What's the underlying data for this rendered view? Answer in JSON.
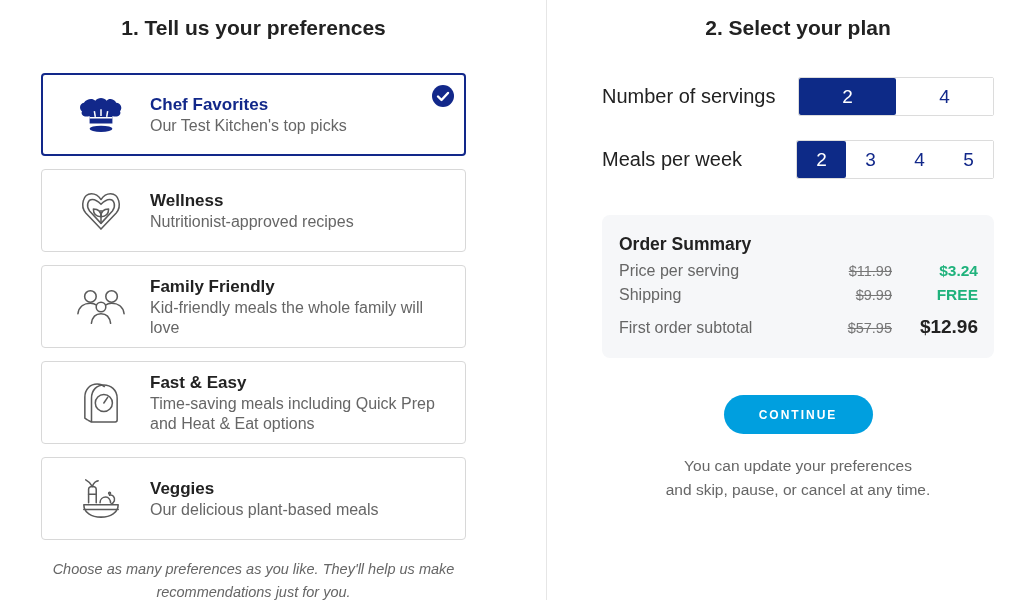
{
  "preferences": {
    "title": "1. Tell us your preferences",
    "options": [
      {
        "title": "Chef Favorites",
        "description": "Our Test Kitchen's top picks",
        "selected": true
      },
      {
        "title": "Wellness",
        "description": "Nutritionist-approved recipes",
        "selected": false
      },
      {
        "title": "Family Friendly",
        "description": "Kid-friendly meals the whole family will love",
        "selected": false
      },
      {
        "title": "Fast & Easy",
        "description": "Time-saving meals including Quick Prep and Heat & Eat options",
        "selected": false
      },
      {
        "title": "Veggies",
        "description": "Our delicious plant-based meals",
        "selected": false
      }
    ],
    "note": "Choose as many preferences as you like. They'll help us make recommendations just for you."
  },
  "plan": {
    "title": "2. Select your plan",
    "servings": {
      "label": "Number of servings",
      "options": [
        {
          "label": "2",
          "selected": true
        },
        {
          "label": "4",
          "selected": false
        }
      ]
    },
    "meals_per_week": {
      "label": "Meals per week",
      "options": [
        {
          "label": "2",
          "selected": true
        },
        {
          "label": "3",
          "selected": false
        },
        {
          "label": "4",
          "selected": false
        },
        {
          "label": "5",
          "selected": false
        }
      ]
    },
    "order_summary": {
      "title": "Order Summary",
      "rows": [
        {
          "kind": "discount",
          "label": "Price per serving",
          "original_price": "$11.99",
          "price": "$3.24"
        },
        {
          "kind": "discount",
          "label": "Shipping",
          "original_price": "$9.99",
          "price": "FREE"
        },
        {
          "kind": "total",
          "label": "First order subtotal",
          "original_price": "$57.95",
          "price": "$12.96"
        }
      ]
    },
    "continue_button": "CONTINUE",
    "note": "You can update your preferences\nand skip, pause, or cancel at any time."
  }
}
